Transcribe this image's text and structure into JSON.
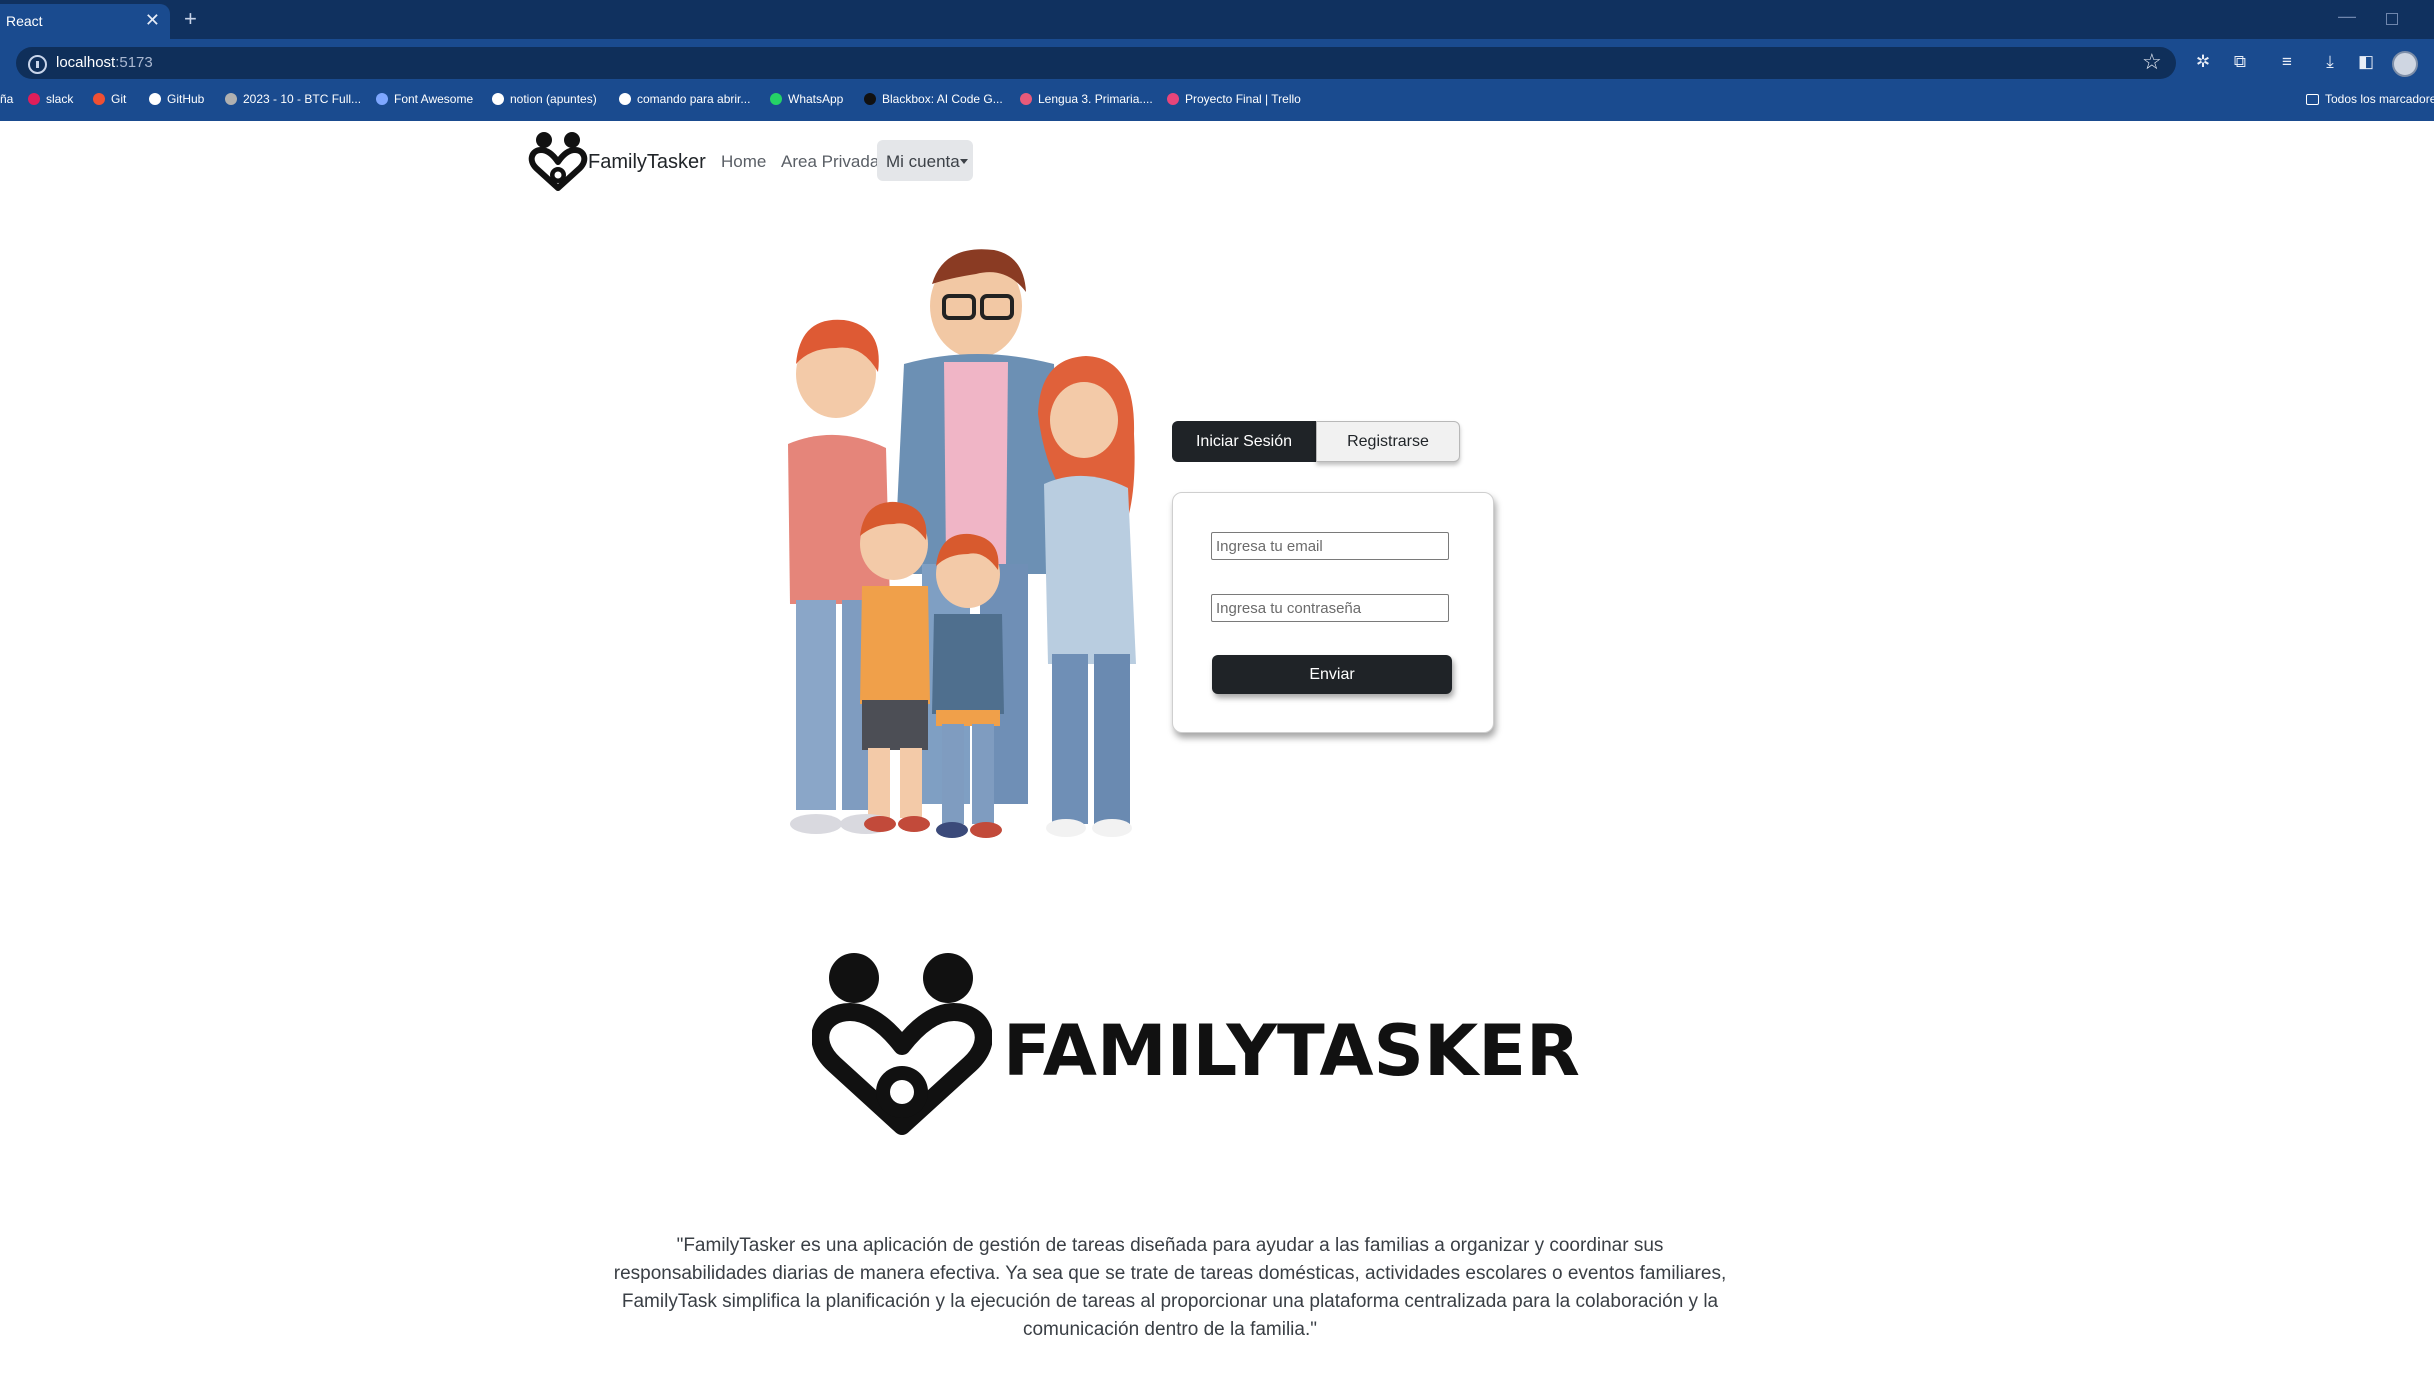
{
  "browser": {
    "tab_title": "React",
    "tab_close": "✕",
    "new_tab": "+",
    "url_host": "localhost",
    "url_port": ":5173",
    "bookmarks": [
      {
        "label": "ña",
        "color": "#1a4b8f",
        "icon": "none"
      },
      {
        "label": "slack",
        "color": "#e01e5a",
        "icon": "slack-icon"
      },
      {
        "label": "Git",
        "color": "#f05033",
        "icon": "git-icon"
      },
      {
        "label": "GitHub",
        "color": "#ffffff",
        "icon": "github-icon"
      },
      {
        "label": "2023 - 10 - BTC Full...",
        "color": "#b0b0b0",
        "icon": "page-icon"
      },
      {
        "label": "Font Awesome",
        "color": "#7ea7ff",
        "icon": "flag-icon"
      },
      {
        "label": "notion (apuntes)",
        "color": "#ffffff",
        "icon": "notion-icon"
      },
      {
        "label": "comando para abrir...",
        "color": "#ffffff",
        "icon": "google-icon"
      },
      {
        "label": "WhatsApp",
        "color": "#25d366",
        "icon": "whatsapp-icon"
      },
      {
        "label": "Blackbox: AI Code G...",
        "color": "#111111",
        "icon": "blackbox-icon"
      },
      {
        "label": "Lengua 3. Primaria....",
        "color": "#e85a7a",
        "icon": "circle-icon"
      },
      {
        "label": "Proyecto Final | Trello",
        "color": "#e8457a",
        "icon": "trello-icon"
      }
    ],
    "all_bookmarks": "Todos los marcadores"
  },
  "navbar": {
    "brand": "FamilyTasker",
    "links": [
      "Home",
      "Area Privada"
    ],
    "account": "Mi cuenta"
  },
  "auth": {
    "tab_login": "Iniciar Sesión",
    "tab_register": "Registrarse",
    "email_placeholder": "Ingresa tu email",
    "password_placeholder": "Ingresa tu contraseña",
    "submit": "Enviar"
  },
  "hero": {
    "wordmark": "FAMILYTASKER",
    "description": "\"FamilyTasker es una aplicación de gestión de tareas diseñada para ayudar a las familias a organizar y coordinar sus responsabilidades diarias de manera efectiva. Ya sea que se trate de tareas domésticas, actividades escolares o eventos familiares, FamilyTask simplifica la planificación y la ejecución de tareas al proporcionar una plataforma centralizada para la colaboración y la comunicación dentro de la familia.\""
  }
}
